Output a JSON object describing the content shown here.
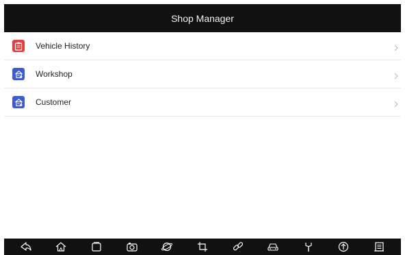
{
  "header": {
    "title": "Shop Manager"
  },
  "menu": [
    {
      "label": "Vehicle History",
      "icon": "clipboard-icon",
      "color": "#e0403e"
    },
    {
      "label": "Workshop",
      "icon": "workshop-icon",
      "color": "#3f5bd0"
    },
    {
      "label": "Customer",
      "icon": "customer-icon",
      "color": "#3f5bd0"
    }
  ],
  "navbar": {
    "icons": [
      "back-icon",
      "home-icon",
      "recent-apps-icon",
      "camera-icon",
      "browser-icon",
      "crop-icon",
      "link-icon",
      "vehicle-icon",
      "wrench-icon",
      "upload-icon",
      "report-icon"
    ]
  },
  "colors": {
    "header_bg": "#111111",
    "accent_red": "#e0403e",
    "accent_blue": "#3f5bd0"
  }
}
